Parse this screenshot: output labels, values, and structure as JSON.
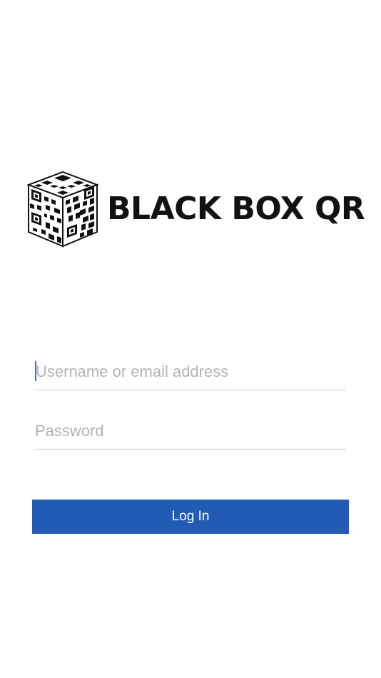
{
  "logo": {
    "text": "BLACK BOX QR",
    "icon": "qr-cube-icon"
  },
  "login_form": {
    "username": {
      "value": "",
      "placeholder": "Username or email address"
    },
    "password": {
      "value": "",
      "placeholder": "Password"
    },
    "submit_label": "Log In"
  },
  "colors": {
    "primary": "#225bb3",
    "caret": "#3b6fd6",
    "placeholder": "#b3b3b5",
    "divider": "#cfcfcf"
  }
}
